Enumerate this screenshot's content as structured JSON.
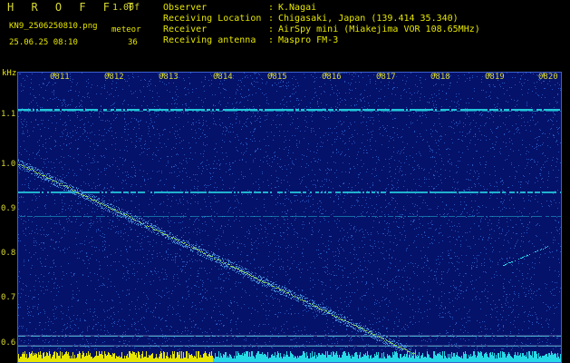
{
  "header": {
    "brand": "H R O F F T",
    "version": "1.00f",
    "filename": "KN9_2506250810.png",
    "datetime": "25.06.25 08:10",
    "meteor_label": "meteor",
    "meteor_count": "36"
  },
  "metadata": [
    {
      "label": "Observer",
      "value": "K.Nagai"
    },
    {
      "label": "Receiving Location",
      "value": "Chigasaki, Japan (139.414 35.340)"
    },
    {
      "label": "Receiver",
      "value": "AirSpy mini (Miakejima VOR 108.65MHz)"
    },
    {
      "label": "Receiving antenna",
      "value": "Maspro FM-3"
    }
  ],
  "colon": ":",
  "axis": {
    "unit": "kHz",
    "y_ticks": [
      "1.1",
      "1.0",
      "0.9",
      "0.8",
      "0.7",
      "0.6"
    ],
    "x_ticks": [
      "0811",
      "0812",
      "0813",
      "0814",
      "0815",
      "0816",
      "0817",
      "0818",
      "0819",
      "0820"
    ]
  },
  "colors": {
    "background": "#05126a",
    "noise": "#2e6bd8",
    "trace": "#8fd45a",
    "band": "#26d9e6",
    "meter_yellow": "#e6e600",
    "meter_cyan": "#26d9e6"
  }
}
